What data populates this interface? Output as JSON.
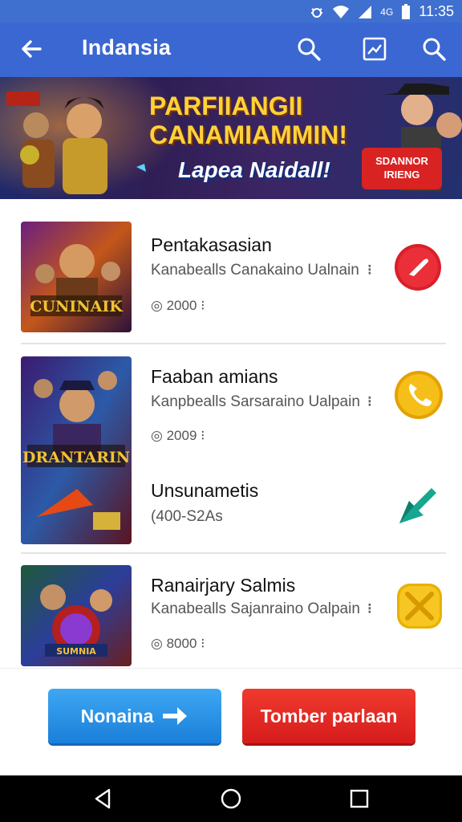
{
  "status_bar": {
    "time": "11:35",
    "signal_text": "4G"
  },
  "app_bar": {
    "title": "Indansia"
  },
  "banner": {
    "title_line1": "PARFIIANGII",
    "title_line2": "CANAMIAMMIN!",
    "subtitle": "Lapea Naidall!",
    "button_line1": "SDANNOR",
    "button_line2": "IRIENG"
  },
  "items": [
    {
      "title": "Pentakasasian",
      "subtitle": "Kanabealls Canakaino Ualnain",
      "meta": "2000",
      "thumb_text": "CUNINAIK"
    },
    {
      "title": "Faaban amians",
      "subtitle": "Kanpbealls Sarsaraino Ualpain",
      "meta": "2009",
      "thumb_text": "DRANTARIN"
    },
    {
      "title": "Unsunametis",
      "subtitle": "(400-S2As",
      "meta": ""
    },
    {
      "title": "Ranairjary Salmis",
      "subtitle": "Kanabealls Sajanraino Oalpain",
      "meta": "8000",
      "thumb_text": "SUMNIA"
    }
  ],
  "buttons": {
    "primary": "Nonaina",
    "secondary": "Tomber parlaan"
  },
  "colors": {
    "appbar": "#3b67d2",
    "blue_button": "#1a7fd9",
    "red_button": "#d61c1c"
  }
}
